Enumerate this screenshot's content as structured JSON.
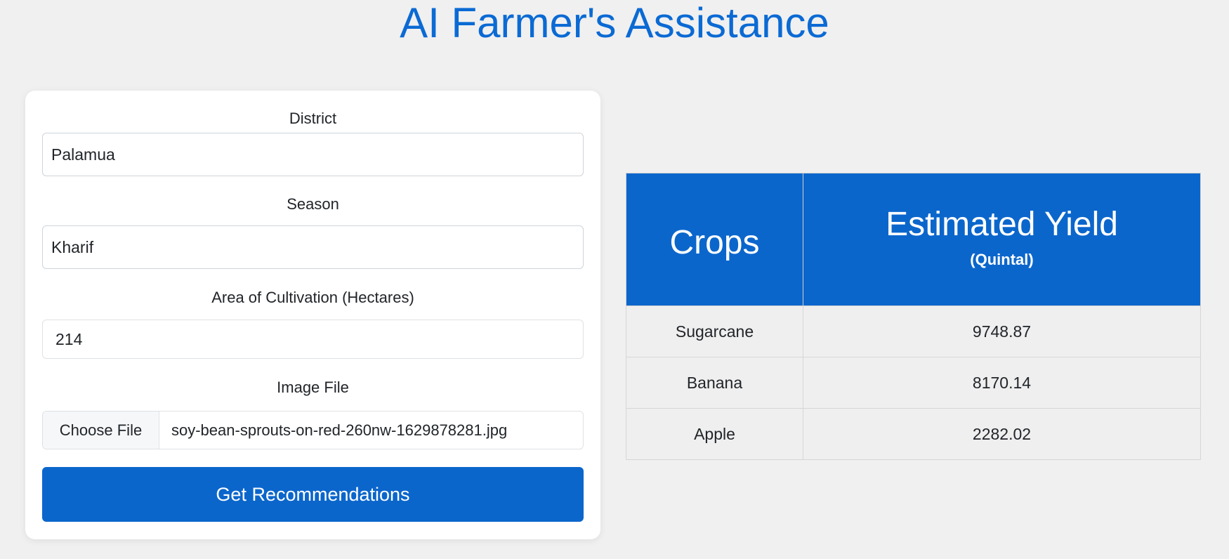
{
  "header": {
    "title": "AI Farmer's Assistance"
  },
  "form": {
    "district": {
      "label": "District",
      "value": "Palamua"
    },
    "season": {
      "label": "Season",
      "value": "Kharif"
    },
    "area": {
      "label": "Area of Cultivation (Hectares)",
      "value": "214"
    },
    "image_file": {
      "label": "Image File",
      "button_label": "Choose File",
      "file_name": "soy-bean-sprouts-on-red-260nw-1629878281.jpg"
    },
    "submit_label": "Get Recommendations"
  },
  "results": {
    "headers": {
      "crops": "Crops",
      "yield": "Estimated Yield",
      "yield_unit": "(Quintal)"
    },
    "rows": [
      {
        "crop": "Sugarcane",
        "yield": "9748.87"
      },
      {
        "crop": "Banana",
        "yield": "8170.14"
      },
      {
        "crop": "Apple",
        "yield": "2282.02"
      }
    ]
  },
  "colors": {
    "accent": "#0b66cc",
    "title": "#0b6ad4",
    "background": "#f0f0f0"
  }
}
